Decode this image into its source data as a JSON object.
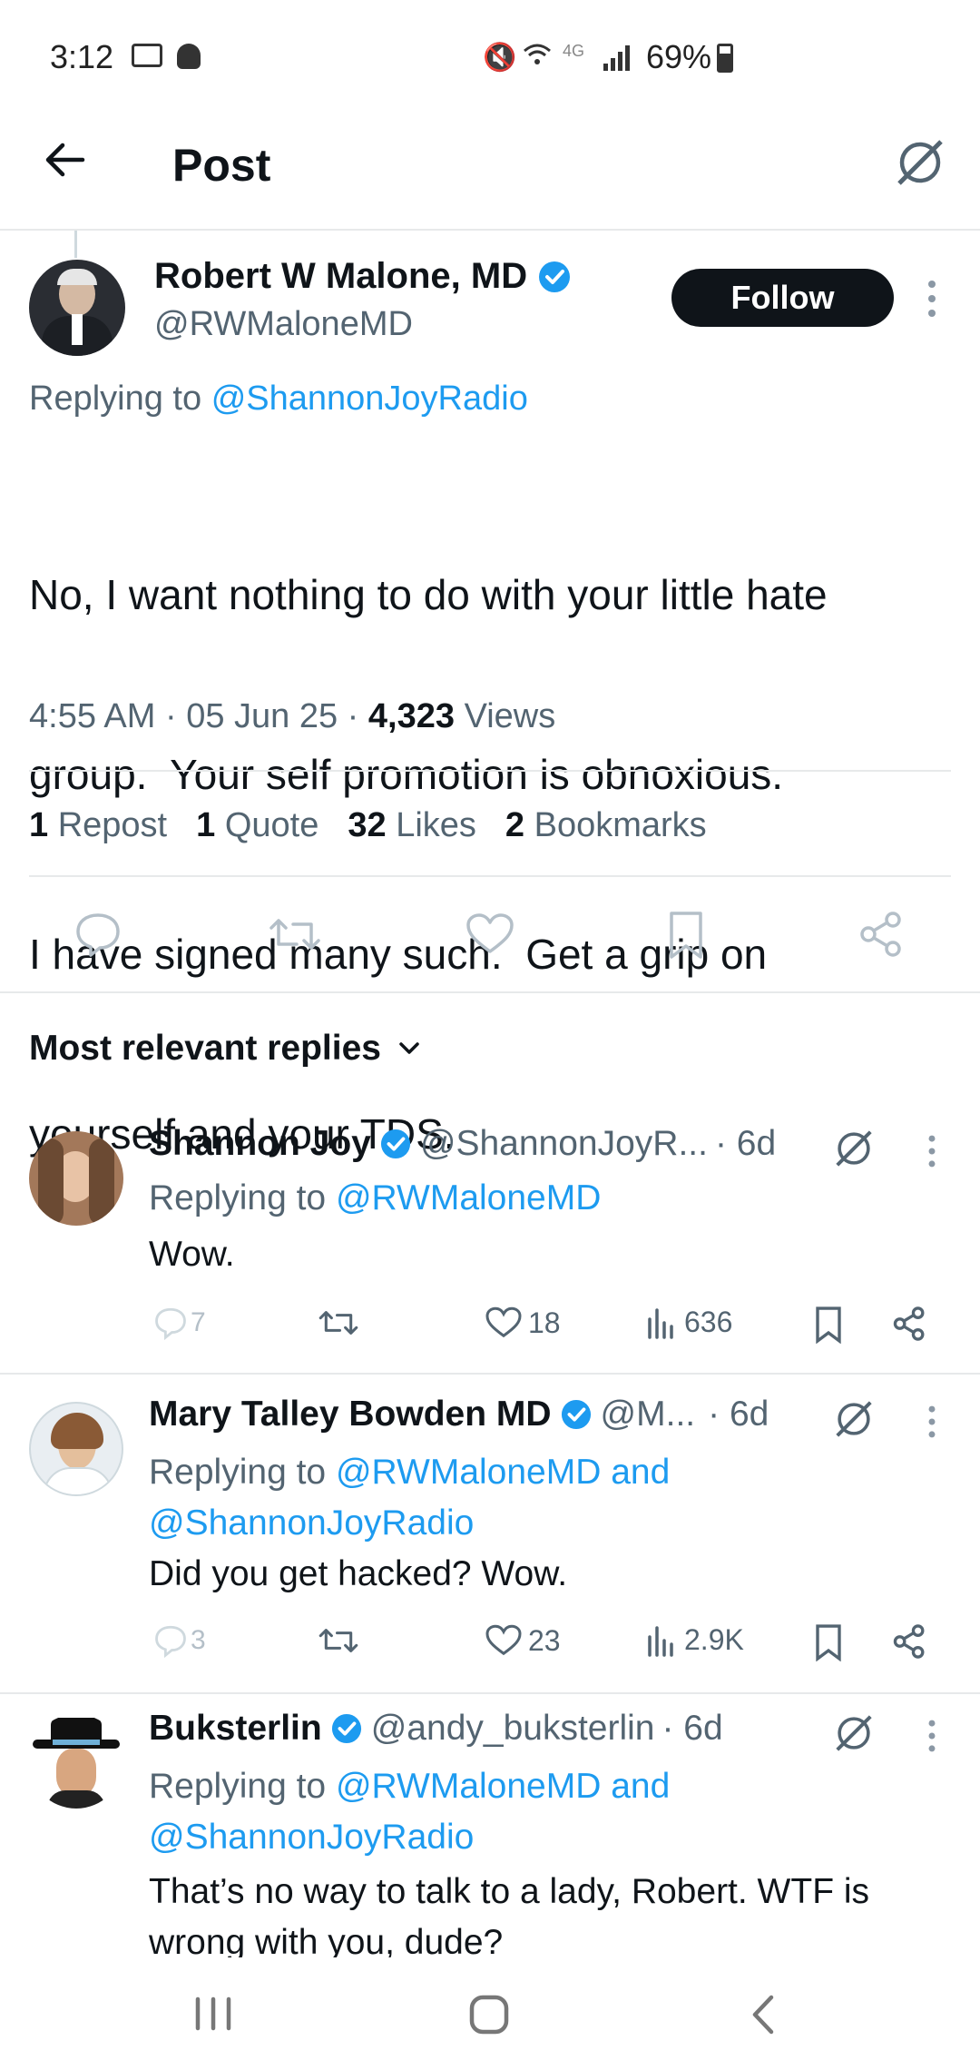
{
  "status_bar": {
    "time": "3:12",
    "network": "4G",
    "battery": "69%"
  },
  "header": {
    "title": "Post"
  },
  "tweet": {
    "name": "Robert W Malone, MD",
    "handle": "@RWMaloneMD",
    "follow_label": "Follow",
    "replying_prefix": "Replying to",
    "replying_handle": "@ShannonJoyRadio",
    "body_lines": [
      "No, I want nothing to do with your little hate",
      "group.  Your self promotion is obnoxious.",
      "I have signed many such.  Get a grip on",
      "yourself and your TDS."
    ],
    "time": "4:55 AM",
    "date": "05 Jun 25",
    "views_count": "4,323",
    "views_label": "Views",
    "stats": {
      "reposts_count": "1",
      "reposts_label": "Repost",
      "quotes_count": "1",
      "quotes_label": "Quote",
      "likes_count": "32",
      "likes_label": "Likes",
      "bookmarks_count": "2",
      "bookmarks_label": "Bookmarks"
    }
  },
  "replies_header": {
    "label": "Most relevant replies"
  },
  "replies": [
    {
      "name": "Shannon Joy",
      "handle": "@ShannonJoyR...",
      "age": "· 6d",
      "replying_prefix": "Replying to",
      "replying_line1": "@RWMaloneMD",
      "replying_line2": "",
      "text_lines": [
        "Wow."
      ],
      "comments": "7",
      "likes": "18",
      "views": "636"
    },
    {
      "name": "Mary Talley Bowden MD",
      "handle": "@M...",
      "age": "· 6d",
      "replying_prefix": "Replying to",
      "replying_line1": "@RWMaloneMD and",
      "replying_line2": "@ShannonJoyRadio",
      "text_lines": [
        "Did you get hacked? Wow."
      ],
      "comments": "3",
      "likes": "23",
      "views": "2.9K"
    },
    {
      "name": "Buksterlin",
      "handle": "@andy_buksterlin",
      "age": "· 6d",
      "replying_prefix": "Replying to",
      "replying_line1": "@RWMaloneMD and",
      "replying_line2": "@ShannonJoyRadio",
      "text_lines": [
        "That’s no way to talk to a lady, Robert. WTF is",
        "wrong with you, dude?"
      ]
    }
  ],
  "colors": {
    "accent": "#1d9bf0",
    "text": "#0f1419",
    "secondary": "#536471",
    "divider": "#e7e9ea"
  }
}
